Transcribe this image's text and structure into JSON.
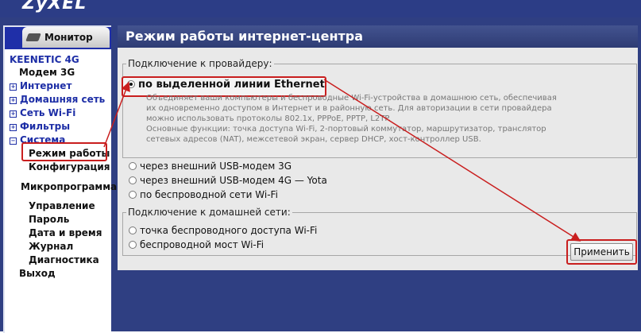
{
  "header": {
    "logo_text": "ZyXEL"
  },
  "sidebar": {
    "monitor_tab": "Монитор",
    "root": "KEENETIC 4G",
    "items": [
      {
        "label": "Модем 3G"
      },
      {
        "label": "Интернет"
      },
      {
        "label": "Домашняя сеть"
      },
      {
        "label": "Сеть Wi-Fi"
      },
      {
        "label": "Фильтры"
      },
      {
        "label": "Система"
      },
      {
        "label": "Режим работы"
      },
      {
        "label": "Конфигурация"
      },
      {
        "label": "Микропрограмма"
      },
      {
        "label": "Управление"
      },
      {
        "label": "Пароль"
      },
      {
        "label": "Дата и время"
      },
      {
        "label": "Журнал"
      },
      {
        "label": "Диагностика"
      },
      {
        "label": "Выход"
      }
    ]
  },
  "main": {
    "title": "Режим работы интернет-центра",
    "provider_group": {
      "legend": "Подключение к провайдеру:",
      "options": [
        {
          "label": "по выделенной линии Ethernet",
          "selected": true
        },
        {
          "label": "через внешний USB-модем 3G",
          "selected": false
        },
        {
          "label": "через внешний USB-модем 4G — Yota",
          "selected": false
        },
        {
          "label": "по беспроводной сети Wi-Fi",
          "selected": false
        }
      ],
      "desc1": "Объединяет ваши компьютеры и беспроводные Wi-Fi-устройства в домашнюю сеть, обеспечивая их одновременно доступом в Интернет и в районную сеть. Для авторизации в сети провайдера можно использовать протоколы 802.1x, PPPoE, PPTP, L2TP.",
      "desc2": "Основные функции: точка доступа Wi-Fi, 2-портовый коммутатор, маршрутизатор, транслятор сетевых адресов (NAT), межсетевой экран, сервер DHCP, хост-контроллер USB."
    },
    "home_group": {
      "legend": "Подключение к домашней сети:",
      "options": [
        {
          "label": "точка беспроводного доступа Wi-Fi",
          "selected": false
        },
        {
          "label": "беспроводной мост Wi-Fi",
          "selected": false
        }
      ]
    },
    "apply_label": "Применить"
  },
  "colors": {
    "highlight": "#c91e1e",
    "nav_blue": "#1d2ea6",
    "title_bar": "#2e3c74"
  }
}
